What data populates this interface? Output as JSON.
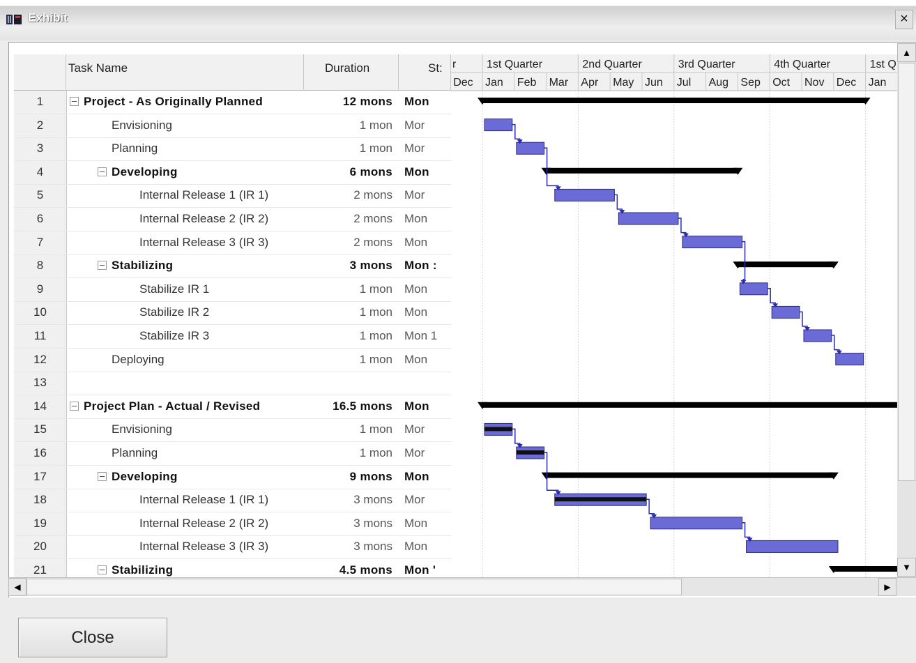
{
  "window": {
    "title": "Exhibit",
    "close_glyph": "×"
  },
  "table": {
    "headers": {
      "task_name": "Task Name",
      "duration": "Duration",
      "start": "St:"
    },
    "rows": [
      {
        "id": "1",
        "name": "Project - As Originally Planned",
        "duration": "12 mons",
        "start": "Mon",
        "level": 0,
        "summary": true,
        "toggle": true
      },
      {
        "id": "2",
        "name": "Envisioning",
        "duration": "1 mon",
        "start": "Mor",
        "level": 1,
        "summary": false,
        "toggle": false
      },
      {
        "id": "3",
        "name": "Planning",
        "duration": "1 mon",
        "start": "Mor",
        "level": 1,
        "summary": false,
        "toggle": false
      },
      {
        "id": "4",
        "name": "Developing",
        "duration": "6 mons",
        "start": "Mon",
        "level": 1,
        "summary": true,
        "toggle": true
      },
      {
        "id": "5",
        "name": "Internal Release 1 (IR 1)",
        "duration": "2 mons",
        "start": "Mor",
        "level": 2,
        "summary": false,
        "toggle": false
      },
      {
        "id": "6",
        "name": "Internal Release 2 (IR 2)",
        "duration": "2 mons",
        "start": "Mon",
        "level": 2,
        "summary": false,
        "toggle": false
      },
      {
        "id": "7",
        "name": "Internal Release 3 (IR 3)",
        "duration": "2 mons",
        "start": "Mon",
        "level": 2,
        "summary": false,
        "toggle": false
      },
      {
        "id": "8",
        "name": "Stabilizing",
        "duration": "3 mons",
        "start": "Mon :",
        "level": 1,
        "summary": true,
        "toggle": true
      },
      {
        "id": "9",
        "name": "Stabilize IR 1",
        "duration": "1 mon",
        "start": "Mon",
        "level": 2,
        "summary": false,
        "toggle": false
      },
      {
        "id": "10",
        "name": "Stabilize IR 2",
        "duration": "1 mon",
        "start": "Mon",
        "level": 2,
        "summary": false,
        "toggle": false
      },
      {
        "id": "11",
        "name": "Stabilize IR 3",
        "duration": "1 mon",
        "start": "Mon 1",
        "level": 2,
        "summary": false,
        "toggle": false
      },
      {
        "id": "12",
        "name": "Deploying",
        "duration": "1 mon",
        "start": "Mon",
        "level": 1,
        "summary": false,
        "toggle": false
      },
      {
        "id": "13",
        "name": "",
        "duration": "",
        "start": "",
        "level": 0,
        "summary": false,
        "toggle": false
      },
      {
        "id": "14",
        "name": "Project Plan - Actual / Revised",
        "duration": "16.5 mons",
        "start": "Mon",
        "level": 0,
        "summary": true,
        "toggle": true
      },
      {
        "id": "15",
        "name": "Envisioning",
        "duration": "1 mon",
        "start": "Mor",
        "level": 1,
        "summary": false,
        "toggle": false
      },
      {
        "id": "16",
        "name": "Planning",
        "duration": "1 mon",
        "start": "Mor",
        "level": 1,
        "summary": false,
        "toggle": false
      },
      {
        "id": "17",
        "name": "Developing",
        "duration": "9 mons",
        "start": "Mon",
        "level": 1,
        "summary": true,
        "toggle": true
      },
      {
        "id": "18",
        "name": "Internal Release 1 (IR 1)",
        "duration": "3 mons",
        "start": "Mor",
        "level": 2,
        "summary": false,
        "toggle": false
      },
      {
        "id": "19",
        "name": "Internal Release 2 (IR 2)",
        "duration": "3 mons",
        "start": "Mon",
        "level": 2,
        "summary": false,
        "toggle": false
      },
      {
        "id": "20",
        "name": "Internal Release 3 (IR 3)",
        "duration": "3 mons",
        "start": "Mon",
        "level": 2,
        "summary": false,
        "toggle": false
      },
      {
        "id": "21",
        "name": "Stabilizing",
        "duration": "4.5 mons",
        "start": "Mon '",
        "level": 1,
        "summary": true,
        "toggle": true
      }
    ]
  },
  "timescale": {
    "quarters": [
      "r",
      "1st Quarter",
      "2nd Quarter",
      "3rd Quarter",
      "4th Quarter",
      "1st Q"
    ],
    "months": [
      "Dec",
      "Jan",
      "Feb",
      "Mar",
      "Apr",
      "May",
      "Jun",
      "Jul",
      "Aug",
      "Sep",
      "Oct",
      "Nov",
      "Dec",
      "Jan"
    ]
  },
  "gantt": {
    "bars": [
      {
        "row": 1,
        "type": "summary",
        "start": 0,
        "end": 12
      },
      {
        "row": 2,
        "type": "task",
        "start": 0,
        "end": 1
      },
      {
        "row": 3,
        "type": "task",
        "start": 1,
        "end": 2
      },
      {
        "row": 4,
        "type": "summary",
        "start": 2,
        "end": 8
      },
      {
        "row": 5,
        "type": "task",
        "start": 2.2,
        "end": 4.2
      },
      {
        "row": 6,
        "type": "task",
        "start": 4.2,
        "end": 6.2
      },
      {
        "row": 7,
        "type": "task",
        "start": 6.2,
        "end": 8.2
      },
      {
        "row": 8,
        "type": "summary",
        "start": 8,
        "end": 11
      },
      {
        "row": 9,
        "type": "task",
        "start": 8,
        "end": 9
      },
      {
        "row": 10,
        "type": "task",
        "start": 9,
        "end": 10
      },
      {
        "row": 11,
        "type": "task",
        "start": 10,
        "end": 11
      },
      {
        "row": 12,
        "type": "task",
        "start": 11,
        "end": 12
      },
      {
        "row": 14,
        "type": "summary",
        "start": 0,
        "end": 16.5
      },
      {
        "row": 15,
        "type": "task",
        "start": 0,
        "end": 1,
        "baseline": true
      },
      {
        "row": 16,
        "type": "task",
        "start": 1,
        "end": 2,
        "baseline": true
      },
      {
        "row": 17,
        "type": "summary",
        "start": 2,
        "end": 11
      },
      {
        "row": 18,
        "type": "task",
        "start": 2.2,
        "end": 5.2,
        "baseline": true
      },
      {
        "row": 19,
        "type": "task",
        "start": 5.2,
        "end": 8.2
      },
      {
        "row": 20,
        "type": "task",
        "start": 8.2,
        "end": 11.2
      },
      {
        "row": 21,
        "type": "summary",
        "start": 11,
        "end": 15.5
      }
    ]
  },
  "buttons": {
    "close": "Close"
  },
  "scroll": {
    "up": "▲",
    "down": "▼",
    "left": "◀",
    "right": "▶"
  },
  "colors": {
    "task_bar": "#6b6bd8",
    "task_border": "#2a2a7a",
    "summary_bar": "#000000",
    "link": "#2b2bb0"
  }
}
